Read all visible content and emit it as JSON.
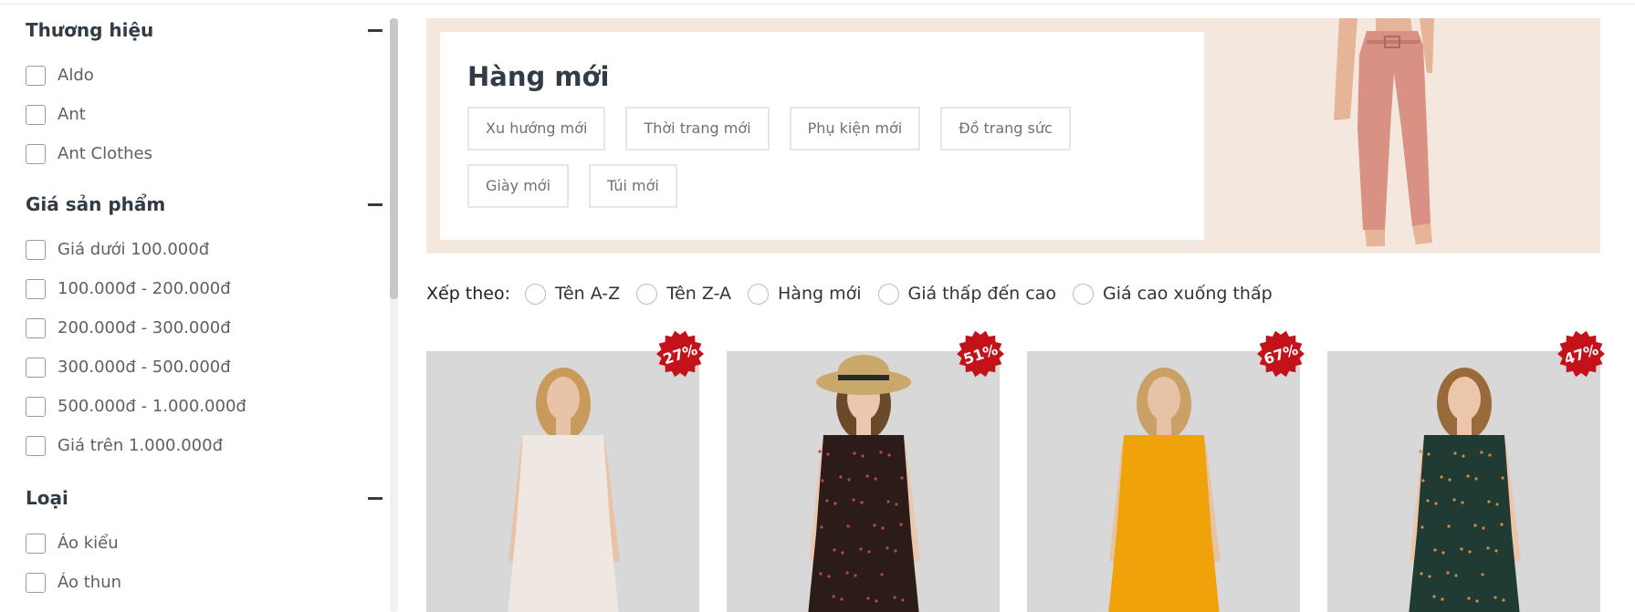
{
  "sidebar": {
    "groups": [
      {
        "title": "Thương hiệu",
        "items": [
          "Aldo",
          "Ant",
          "Ant Clothes"
        ]
      },
      {
        "title": "Giá sản phẩm",
        "items": [
          "Giá dưới 100.000đ",
          "100.000đ - 200.000đ",
          "200.000đ - 300.000đ",
          "300.000đ - 500.000đ",
          "500.000đ - 1.000.000đ",
          "Giá trên 1.000.000đ"
        ]
      },
      {
        "title": "Loại",
        "items": [
          "Áo kiểu",
          "Áo thun"
        ]
      }
    ]
  },
  "banner": {
    "title": "Hàng mới",
    "tags": [
      "Xu hướng mới",
      "Thời trang mới",
      "Phụ kiện mới",
      "Đồ trang sức",
      "Giày mới",
      "Túi mới"
    ]
  },
  "sort": {
    "label": "Xếp theo:",
    "options": [
      "Tên A-Z",
      "Tên Z-A",
      "Hàng mới",
      "Giá thấp đến cao",
      "Giá cao xuống thấp"
    ]
  },
  "products": [
    {
      "discount": "27%",
      "dress_color": "#efe7e1",
      "skin": "#e9c3a8",
      "hair": "#c89a5b"
    },
    {
      "discount": "51%",
      "dress_color": "#2b1c1a",
      "skin": "#eac7ae",
      "hair": "#6b4a2a"
    },
    {
      "discount": "67%",
      "dress_color": "#f0a20a",
      "skin": "#e7c3a6",
      "hair": "#caa066"
    },
    {
      "discount": "47%",
      "dress_color": "#1f3b34",
      "skin": "#ebc6ab",
      "hair": "#9a6b3a"
    }
  ],
  "colors": {
    "badge": "#c4121a",
    "banner_bg": "#f3e7de",
    "pants": "#d99183"
  }
}
